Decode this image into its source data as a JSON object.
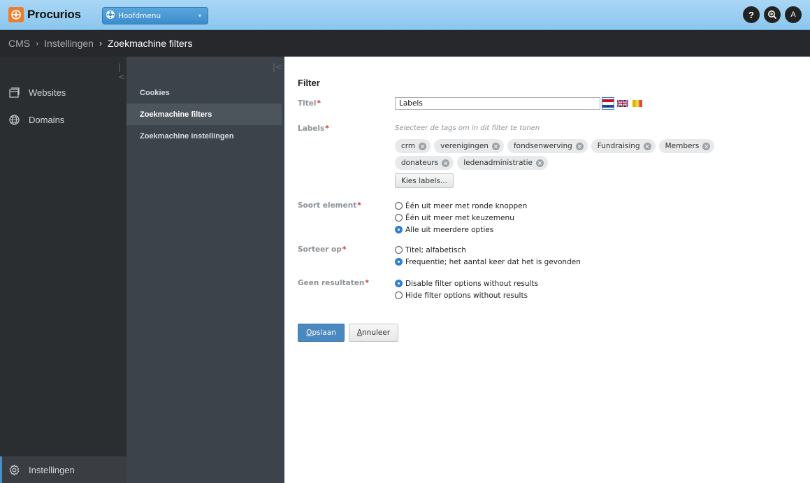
{
  "app": {
    "brand": "Procurios",
    "menu_select": "Hoofdmenu",
    "avatar_letter": "A"
  },
  "breadcrumb": {
    "items": [
      "CMS",
      "Instellingen"
    ],
    "current": "Zoekmachine filters"
  },
  "sidebar": {
    "items": [
      {
        "label": "Websites",
        "icon": "window-icon"
      },
      {
        "label": "Domains",
        "icon": "globe-icon"
      }
    ],
    "bottom": {
      "label": "Instellingen",
      "icon": "gear-icon"
    }
  },
  "subnav": {
    "items": [
      {
        "label": "Cookies"
      },
      {
        "label": "Zoekmachine filters",
        "active": true
      },
      {
        "label": "Zoekmachine instellingen"
      }
    ]
  },
  "form": {
    "section_title": "Filter",
    "required_mark": "*",
    "titel": {
      "label": "Titel",
      "value": "Labels"
    },
    "labels": {
      "label": "Labels",
      "hint": "Selecteer de tags om in dit filter te tonen",
      "tags": [
        "crm",
        "verenigingen",
        "fondsenwerving",
        "Fundraising",
        "Members",
        "donateurs",
        "ledenadministratie"
      ],
      "choose_btn": "Kies labels..."
    },
    "soort": {
      "label": "Soort element",
      "options": [
        "Één uit meer met ronde knoppen",
        "Één uit meer met keuzemenu",
        "Alle uit meerdere opties"
      ],
      "selected": 2
    },
    "sorteer": {
      "label": "Sorteer op",
      "options": [
        "Titel; alfabetisch",
        "Frequentie; het aantal keer dat het is gevonden"
      ],
      "selected": 1
    },
    "geen": {
      "label": "Geen resultaten",
      "options": [
        "Disable filter options without results",
        "Hide filter options without results"
      ],
      "selected": 0
    },
    "save": {
      "first": "O",
      "rest": "pslaan"
    },
    "cancel": {
      "first": "A",
      "rest": "nnuleer"
    }
  },
  "colors": {
    "accent": "#4a88c0",
    "topbar": "#8cc7ee",
    "required": "#d0312d",
    "sidebar": "#2b2e31"
  }
}
